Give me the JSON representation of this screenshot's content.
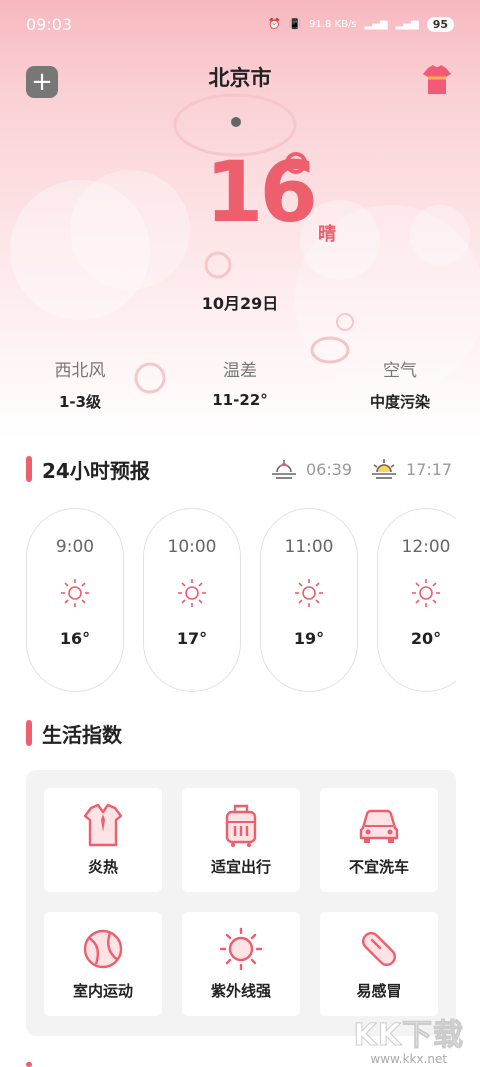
{
  "status_bar": {
    "time": "09:03",
    "net_speed": "91.8 KB/s",
    "battery": "95"
  },
  "header": {
    "city": "北京市"
  },
  "current": {
    "temperature": "16",
    "suffix": "晴",
    "date": "10月29日"
  },
  "stats": [
    {
      "label": "西北风",
      "value": "1-3级"
    },
    {
      "label": "温差",
      "value": "11-22°"
    },
    {
      "label": "空气",
      "value": "中度污染"
    }
  ],
  "forecast": {
    "title": "24小时预报",
    "sunrise": "06:39",
    "sunset": "17:17",
    "hours": [
      {
        "time": "9:00",
        "icon": "sun-icon",
        "temp": "16°"
      },
      {
        "time": "10:00",
        "icon": "sun-icon",
        "temp": "17°"
      },
      {
        "time": "11:00",
        "icon": "sun-icon",
        "temp": "19°"
      },
      {
        "time": "12:00",
        "icon": "sun-icon",
        "temp": "20°"
      }
    ]
  },
  "life": {
    "title": "生活指数",
    "items": [
      {
        "label": "炎热",
        "icon": "shirt-icon"
      },
      {
        "label": "适宜出行",
        "icon": "luggage-icon"
      },
      {
        "label": "不宜洗车",
        "icon": "car-icon"
      },
      {
        "label": "室内运动",
        "icon": "ball-icon"
      },
      {
        "label": "紫外线强",
        "icon": "uv-sun-icon"
      },
      {
        "label": "易感冒",
        "icon": "pill-icon"
      }
    ]
  },
  "watermark": {
    "main": "KK下载",
    "sub": "www.kkx.net"
  },
  "colors": {
    "accent": "#ee5f6d",
    "header_bg": "#f7b8bf"
  }
}
